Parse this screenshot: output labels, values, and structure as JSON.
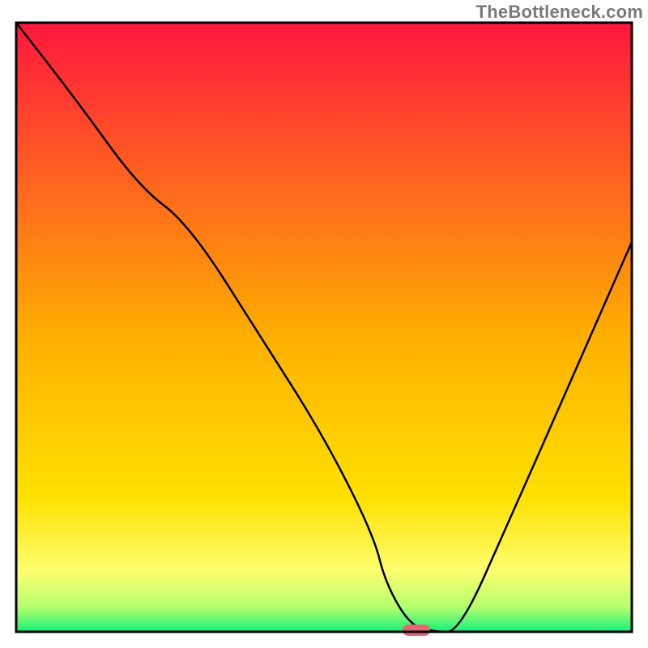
{
  "watermark": "TheBottleneck.com",
  "chart_data": {
    "type": "line",
    "title": "",
    "xlabel": "",
    "ylabel": "",
    "xlim": [
      0,
      100
    ],
    "ylim": [
      0,
      100
    ],
    "series": [
      {
        "name": "curve",
        "x": [
          0,
          10,
          20,
          28,
          40,
          50,
          58,
          60,
          64,
          68,
          72,
          80,
          90,
          100
        ],
        "y": [
          100,
          87,
          73,
          67,
          48,
          32,
          16,
          8,
          1,
          0,
          0,
          18,
          41,
          64
        ]
      }
    ],
    "background_gradient": {
      "top_color": "#ff173e",
      "mid_color": "#ffd400",
      "yellow_band": "#fcff6f",
      "bottom_color": "#14f07a"
    },
    "marker": {
      "x": 65,
      "y": 0,
      "color": "#e36773"
    },
    "axes": {
      "show_ticks": false,
      "show_grid": false,
      "frame": true,
      "frame_color": "#000000"
    }
  }
}
